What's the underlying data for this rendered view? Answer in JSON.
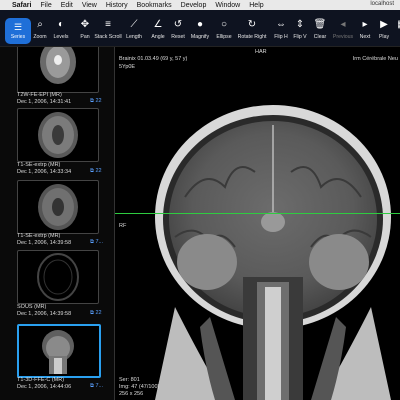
{
  "menubar": {
    "app": "Safari",
    "items": [
      "File",
      "Edit",
      "View",
      "History",
      "Bookmarks",
      "Develop",
      "Window",
      "Help"
    ],
    "url": "localhost"
  },
  "toolbar": {
    "series_label": "Series",
    "tools": [
      {
        "label": "Zoom",
        "icon": "magnifier-icon",
        "glyph": "⌕"
      },
      {
        "label": "Levels",
        "icon": "contrast-icon",
        "glyph": "◐"
      },
      {
        "label": "Pan",
        "icon": "move-icon",
        "glyph": "✥"
      },
      {
        "label": "Stack Scroll",
        "icon": "stack-icon",
        "glyph": "≡"
      },
      {
        "label": "Length",
        "icon": "ruler-icon",
        "glyph": "⟋"
      },
      {
        "label": "Angle",
        "icon": "angle-icon",
        "glyph": "∠"
      },
      {
        "label": "Reset",
        "icon": "reset-icon",
        "glyph": "↺"
      },
      {
        "label": "Magnify",
        "icon": "magnify-dot-icon",
        "glyph": "●"
      },
      {
        "label": "Ellipse",
        "icon": "ellipse-icon",
        "glyph": "○"
      },
      {
        "label": "Rotate Right",
        "icon": "rotate-right-icon",
        "glyph": "↻"
      },
      {
        "label": "Flip H",
        "icon": "flip-h-icon",
        "glyph": "⇔"
      },
      {
        "label": "Flip V",
        "icon": "flip-v-icon",
        "glyph": "⇕"
      },
      {
        "label": "Clear",
        "icon": "trash-icon",
        "glyph": "🗑"
      },
      {
        "label": "Previous",
        "icon": "previous-icon",
        "glyph": "◂",
        "dim": true
      },
      {
        "label": "Next",
        "icon": "next-icon",
        "glyph": "▸"
      },
      {
        "label": "Play",
        "icon": "play-icon",
        "glyph": "▶"
      },
      {
        "label": "C",
        "icon": "cine-icon",
        "glyph": "▦"
      }
    ]
  },
  "series": [
    {
      "name": "T2W-FE-EPI (MR)",
      "date": "Dec 1, 2006, 14:31:41",
      "count": "22"
    },
    {
      "name": "T1-SE-extrp (MR)",
      "date": "Dec 1, 2006, 14:33:34",
      "count": "22"
    },
    {
      "name": "T1-SE-extrp (MR)",
      "date": "Dec 1, 2006, 14:39:58",
      "count": "7..."
    },
    {
      "name": "SOUS (MR)",
      "date": "Dec 1, 2006, 14:39:58",
      "count": "22"
    },
    {
      "name": "T1-3D-FFE-C (MR)",
      "date": "Dec 1, 2006, 14:44:06",
      "count": "7..."
    }
  ],
  "viewer": {
    "top_center": "HAR",
    "patient_name": "Brainix 01.03.49 (69 y, 57 y)",
    "patient_id": "5Yp0E",
    "institution": "Irm Cérébrale Neu",
    "left_marker": "RF",
    "series_num": "Ser: 801",
    "image_num": "Img: 47 (47/100)",
    "dims": "256 x 256"
  },
  "colors": {
    "accent": "#1f6fd8",
    "crosshair": "#2ecc40",
    "highlight": "#2aa0f0"
  }
}
